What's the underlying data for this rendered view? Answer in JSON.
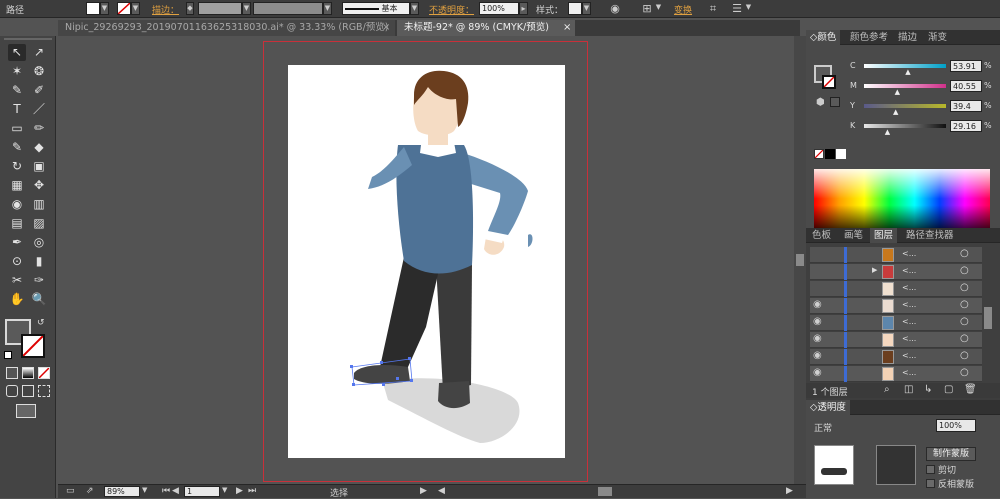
{
  "control_bar": {
    "object_type": "路径",
    "stroke_label": "描边：",
    "stroke_style": "基本",
    "opacity_label": "不透明度：",
    "opacity_value": "100%",
    "style_label": "样式：",
    "transform_label": "变换",
    "dropdown_arrow": "▼",
    "stroke_sep": ":"
  },
  "tabs": [
    {
      "label": "Nipic_29269293_20190701163625318030.ai* @ 33.33% (RGB/预览)",
      "close": "×"
    },
    {
      "label": "未标题-92* @ 89% (CMYK/预览)",
      "close": "×"
    }
  ],
  "tools": [
    "↖",
    "↗",
    "✶",
    "❂",
    "✎",
    "✐",
    "T",
    "／",
    "▭",
    "✏",
    "✎",
    "◆",
    "↻",
    "▣",
    "▦",
    "✥",
    "◉",
    "▥",
    "▤",
    "▨",
    "✒",
    "◎",
    "⊙",
    "▮",
    "✂",
    "✑",
    "✋",
    "🔍"
  ],
  "status_bar": {
    "zoom": "89%",
    "artboard": "1",
    "tool_name": "选择",
    "arrow_left": "◀",
    "arrow_right": "▶"
  },
  "panels": {
    "color_tabs": [
      "颜色",
      "颜色参考",
      "描边",
      "渐变"
    ],
    "cmyk": [
      {
        "label": "C",
        "value": "53.91",
        "color_from": "#ffffff",
        "color_to": "#00a0c8",
        "pos": 0.54
      },
      {
        "label": "M",
        "value": "40.55",
        "color_from": "#ffffff",
        "color_to": "#d0308a",
        "pos": 0.41
      },
      {
        "label": "Y",
        "value": "39.4",
        "color_from": "#5a5a8a",
        "color_to": "#b8b82a",
        "pos": 0.39
      },
      {
        "label": "K",
        "value": "29.16",
        "color_from": "#e8e8e8",
        "color_to": "#101010",
        "pos": 0.29
      }
    ],
    "percent_sign": "%",
    "layer_tabs": [
      "色板",
      "画笔",
      "图层",
      "路径查找器"
    ],
    "layers": [
      {
        "name": "<...",
        "thumb_color": "#c8781c"
      },
      {
        "name": "<...",
        "thumb_color": "#c83c3c",
        "expanded": true
      },
      {
        "name": "<...",
        "thumb_color": "#f0e0d0"
      },
      {
        "name": "<...",
        "thumb_color": "#eadbd0",
        "visible": true
      },
      {
        "name": "<...",
        "thumb_color": "#5d86ac",
        "visible": true
      },
      {
        "name": "<...",
        "thumb_color": "#f5d8c0",
        "visible": true
      },
      {
        "name": "<...",
        "thumb_color": "#6b3e1e",
        "visible": true
      },
      {
        "name": "<...",
        "thumb_color": "#f3d2b5",
        "visible": true
      }
    ],
    "layer_count": "1 个图层",
    "transparency_tab": "透明度",
    "blend_mode": "正常",
    "opacity_value": "100%",
    "make_mask_button": "制作蒙版",
    "clip_label": "剪切",
    "invert_mask_label": "反相蒙版"
  },
  "illustration": {
    "skin": "#f5dcc4",
    "hair": "#6b3e1e",
    "sweater": "#4e7296",
    "sweater_light": "#6a90b3",
    "pants": "#2b2b2b",
    "shoe": "#444444",
    "shadow": "#d9d9d9",
    "collar": "#ffffff"
  }
}
